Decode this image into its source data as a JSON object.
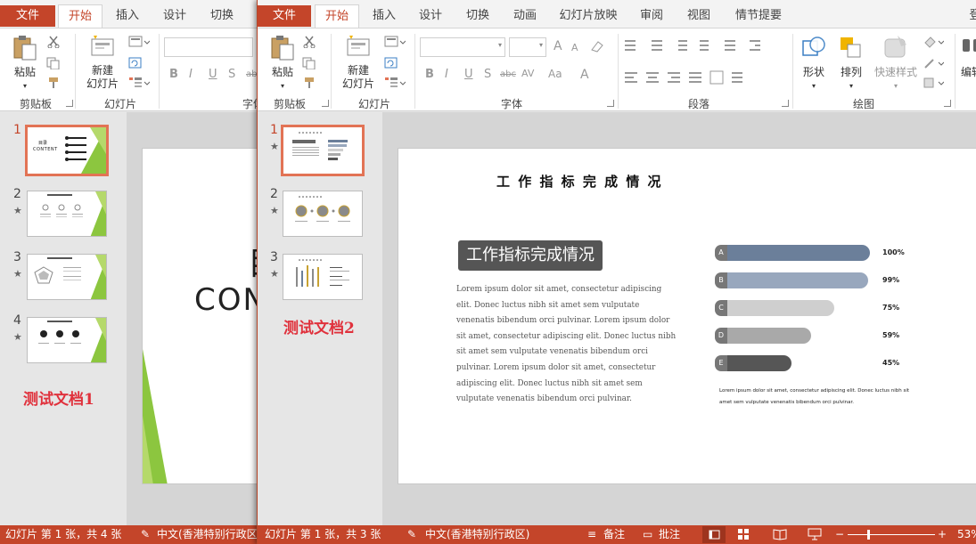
{
  "window1": {
    "tabs": [
      "文件",
      "开始",
      "插入",
      "设计",
      "切换"
    ],
    "ribbon": {
      "paste_label": "粘贴",
      "new_slide_label1": "新建",
      "new_slide_label2": "幻灯片",
      "group_clipboard": "剪贴板",
      "group_slides": "幻灯片",
      "group_font_partial": "字体",
      "bold": "B",
      "italic": "I",
      "underline": "U",
      "shadow": "S",
      "strike": "abc"
    },
    "slides": [
      {
        "num": "1"
      },
      {
        "num": "2"
      },
      {
        "num": "3"
      },
      {
        "num": "4"
      }
    ],
    "doc_label": "测试文档1",
    "thumb1_title": "目录",
    "thumb1_subtitle": "CONTENT",
    "main_slide_title": "目",
    "main_slide_subtitle": "CONTENT",
    "status": {
      "slide_info": "幻灯片 第 1 张，共 4 张",
      "language": "中文(香港特别行政区)"
    }
  },
  "window2": {
    "tabs": [
      "文件",
      "开始",
      "插入",
      "设计",
      "切换",
      "动画",
      "幻灯片放映",
      "审阅",
      "视图",
      "情节提要",
      "登"
    ],
    "ribbon": {
      "paste_label": "粘贴",
      "new_slide_label1": "新建",
      "new_slide_label2": "幻灯片",
      "shape_label": "形状",
      "arrange_label": "排列",
      "quick_style_label": "快速样式",
      "edit_label": "编辑",
      "group_clipboard": "剪贴板",
      "group_slides": "幻灯片",
      "group_font": "字体",
      "group_paragraph": "段落",
      "group_drawing": "绘图",
      "bold": "B",
      "italic": "I",
      "underline": "U",
      "shadow": "S",
      "strike": "abc",
      "char_spacing": "AV",
      "change_case": "Aa",
      "font_color": "A",
      "grow": "A",
      "shrink": "A"
    },
    "slides": [
      {
        "num": "1"
      },
      {
        "num": "2"
      },
      {
        "num": "3"
      }
    ],
    "doc_label": "测试文档2",
    "slide": {
      "title": "工 作 指 标 完 成 情 况",
      "badge": "工作指标完成情况",
      "body": "Lorem ipsum dolor sit amet, consectetur adipiscing elit. Donec luctus nibh sit amet sem vulputate venenatis bibendum orci pulvinar. Lorem ipsum dolor sit amet, consectetur adipiscing elit. Donec luctus nibh sit amet sem vulputate venenatis bibendum orci pulvinar. Lorem ipsum dolor sit amet, consectetur adipiscing elit. Donec luctus nibh sit amet sem vulputate venenatis bibendum orci pulvinar.",
      "caption": "Lorem ipsum dolor sit amet, consectetur adipiscing elit. Donec luctus nibh sit amet sem vulputate venenatis bibendum orci pulvinar.",
      "bars": [
        {
          "letter": "A",
          "value": 100,
          "label": "100%",
          "color": "#6b7f9a"
        },
        {
          "letter": "B",
          "value": 99,
          "label": "99%",
          "color": "#98a7bd"
        },
        {
          "letter": "C",
          "value": 75,
          "label": "75%",
          "color": "#cfcfcf"
        },
        {
          "letter": "D",
          "value": 59,
          "label": "59%",
          "color": "#a9a9a9"
        },
        {
          "letter": "E",
          "value": 45,
          "label": "45%",
          "color": "#565656"
        }
      ]
    },
    "status": {
      "slide_info": "幻灯片 第 1 张，共 3 张",
      "language": "中文(香港特别行政区)",
      "notes": "备注",
      "comments": "批注",
      "zoom": "53%"
    }
  },
  "colors": {
    "accent": "#c4452a",
    "selected_thumb_border": "#e27355",
    "doc_label": "#e0313c",
    "green": "#8cc63f"
  }
}
